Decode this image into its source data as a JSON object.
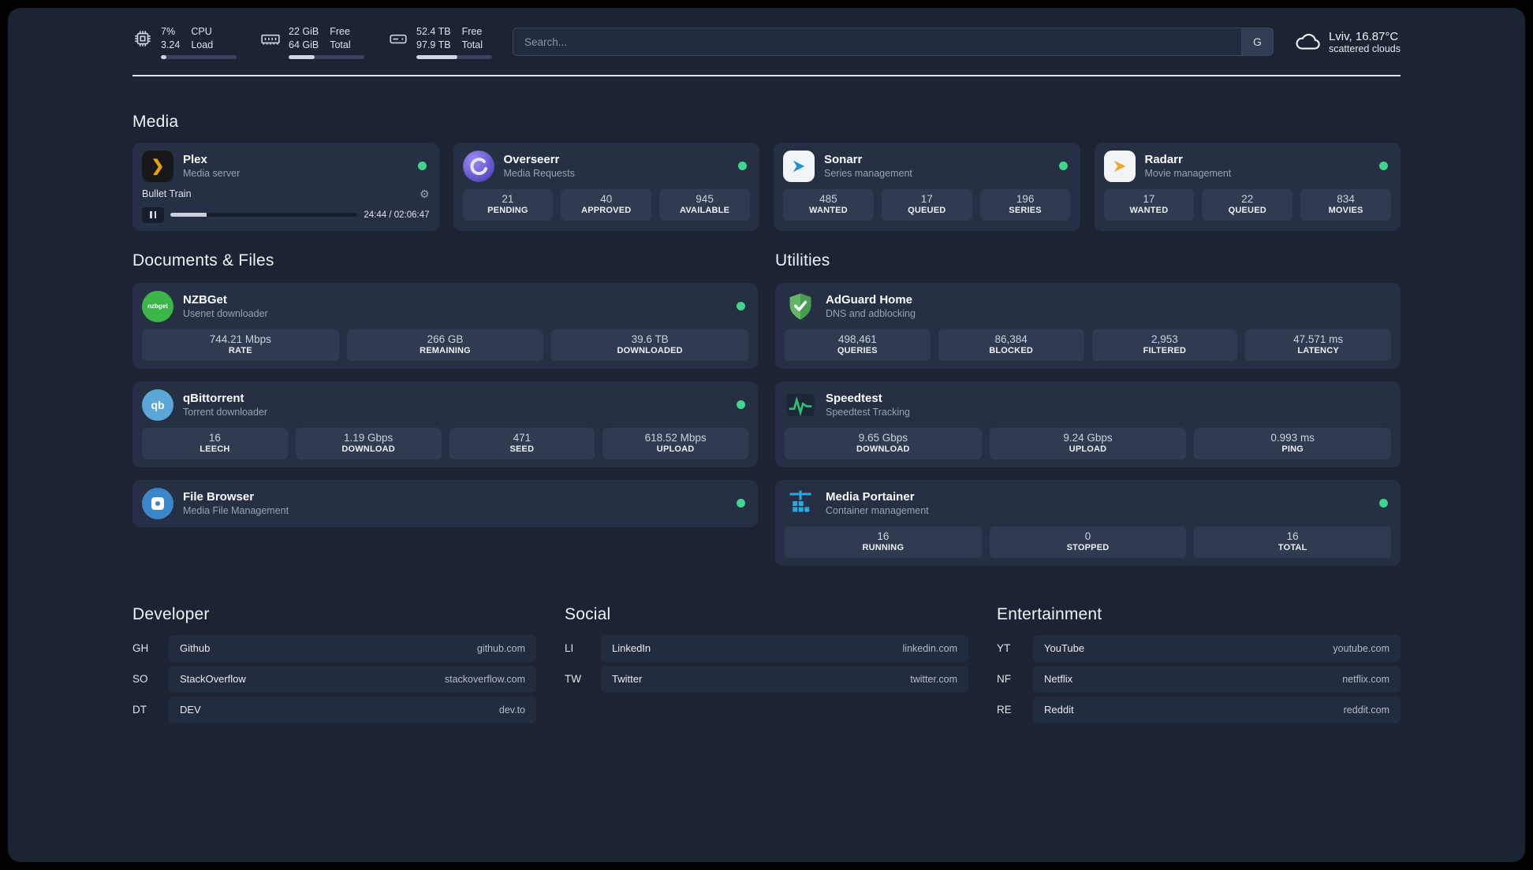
{
  "topbar": {
    "cpu": {
      "value": "7%",
      "sub": "3.24",
      "label_top": "CPU",
      "label_bottom": "Load",
      "percent": 7
    },
    "ram": {
      "value": "22 GiB",
      "sub": "64 GiB",
      "label_top": "Free",
      "label_bottom": "Total",
      "percent": 34
    },
    "disk": {
      "value": "52.4 TB",
      "sub": "97.9 TB",
      "label_top": "Free",
      "label_bottom": "Total",
      "percent": 54
    },
    "search": {
      "placeholder": "Search...",
      "engine": "G"
    },
    "weather": {
      "location": "Lviv, 16.87°C",
      "condition": "scattered clouds"
    }
  },
  "section_titles": {
    "media": "Media",
    "documents": "Documents & Files",
    "utilities": "Utilities",
    "developer": "Developer",
    "social": "Social",
    "entertainment": "Entertainment"
  },
  "apps": {
    "plex": {
      "name": "Plex",
      "desc": "Media server",
      "now_playing": "Bullet Train",
      "time": "24:44 / 02:06:47",
      "progress_percent": 19.5
    },
    "overseerr": {
      "name": "Overseerr",
      "desc": "Media Requests",
      "stats": [
        {
          "value": "21",
          "label": "PENDING"
        },
        {
          "value": "40",
          "label": "APPROVED"
        },
        {
          "value": "945",
          "label": "AVAILABLE"
        }
      ]
    },
    "sonarr": {
      "name": "Sonarr",
      "desc": "Series management",
      "stats": [
        {
          "value": "485",
          "label": "WANTED"
        },
        {
          "value": "17",
          "label": "QUEUED"
        },
        {
          "value": "196",
          "label": "SERIES"
        }
      ]
    },
    "radarr": {
      "name": "Radarr",
      "desc": "Movie management",
      "stats": [
        {
          "value": "17",
          "label": "WANTED"
        },
        {
          "value": "22",
          "label": "QUEUED"
        },
        {
          "value": "834",
          "label": "MOVIES"
        }
      ]
    },
    "nzbget": {
      "name": "NZBGet",
      "desc": "Usenet downloader",
      "icon_text": "nzbget",
      "stats": [
        {
          "value": "744.21 Mbps",
          "label": "RATE"
        },
        {
          "value": "266 GB",
          "label": "REMAINING"
        },
        {
          "value": "39.6 TB",
          "label": "DOWNLOADED"
        }
      ]
    },
    "qbittorrent": {
      "name": "qBittorrent",
      "desc": "Torrent downloader",
      "icon_text": "qb",
      "stats": [
        {
          "value": "16",
          "label": "LEECH"
        },
        {
          "value": "1.19 Gbps",
          "label": "DOWNLOAD"
        },
        {
          "value": "471",
          "label": "SEED"
        },
        {
          "value": "618.52 Mbps",
          "label": "UPLOAD"
        }
      ]
    },
    "filebrowser": {
      "name": "File Browser",
      "desc": "Media File Management"
    },
    "adguard": {
      "name": "AdGuard Home",
      "desc": "DNS and adblocking",
      "stats": [
        {
          "value": "498,461",
          "label": "QUERIES"
        },
        {
          "value": "86,384",
          "label": "BLOCKED"
        },
        {
          "value": "2,953",
          "label": "FILTERED"
        },
        {
          "value": "47.571 ms",
          "label": "LATENCY"
        }
      ]
    },
    "speedtest": {
      "name": "Speedtest",
      "desc": "Speedtest Tracking",
      "stats": [
        {
          "value": "9.65 Gbps",
          "label": "DOWNLOAD"
        },
        {
          "value": "9.24 Gbps",
          "label": "UPLOAD"
        },
        {
          "value": "0.993 ms",
          "label": "PING"
        }
      ]
    },
    "portainer": {
      "name": "Media Portainer",
      "desc": "Container management",
      "stats": [
        {
          "value": "16",
          "label": "RUNNING"
        },
        {
          "value": "0",
          "label": "STOPPED"
        },
        {
          "value": "16",
          "label": "TOTAL"
        }
      ]
    }
  },
  "bookmarks": {
    "developer": [
      {
        "abbr": "GH",
        "name": "Github",
        "url": "github.com"
      },
      {
        "abbr": "SO",
        "name": "StackOverflow",
        "url": "stackoverflow.com"
      },
      {
        "abbr": "DT",
        "name": "DEV",
        "url": "dev.to"
      }
    ],
    "social": [
      {
        "abbr": "LI",
        "name": "LinkedIn",
        "url": "linkedin.com"
      },
      {
        "abbr": "TW",
        "name": "Twitter",
        "url": "twitter.com"
      }
    ],
    "entertainment": [
      {
        "abbr": "YT",
        "name": "YouTube",
        "url": "youtube.com"
      },
      {
        "abbr": "NF",
        "name": "Netflix",
        "url": "netflix.com"
      },
      {
        "abbr": "RE",
        "name": "Reddit",
        "url": "reddit.com"
      }
    ]
  },
  "colors": {
    "status_online": "#3dd68c"
  }
}
